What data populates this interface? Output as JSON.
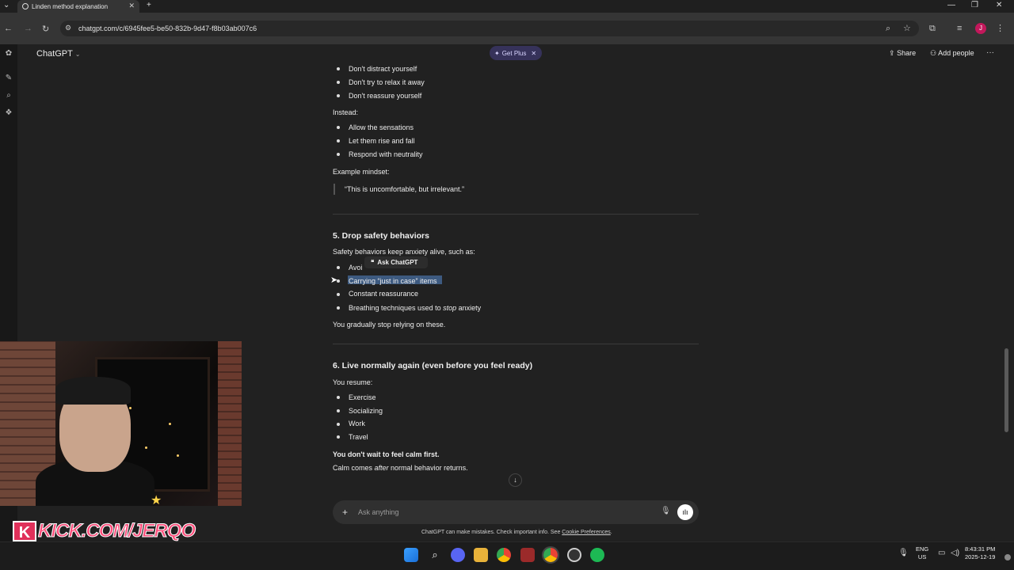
{
  "browser": {
    "tab_title": "Linden method explanation",
    "url": "chatgpt.com/c/6945fee5-be50-832b-9d47-f8b03ab007c6"
  },
  "app": {
    "name": "ChatGPT",
    "get_plus": "Get Plus",
    "share": "Share",
    "add_people": "Add people"
  },
  "content": {
    "list_a": [
      "Don't distract yourself",
      "Don't try to relax it away",
      "Don't reassure yourself"
    ],
    "instead_label": "Instead:",
    "list_b": [
      "Allow the sensations",
      "Let them rise and fall",
      "Respond with neutrality"
    ],
    "example_label": "Example mindset:",
    "quote": "“This is uncomfortable, but irrelevant.”",
    "section5_title": "5. Drop safety behaviors",
    "section5_intro": "Safety behaviors keep anxiety alive, such as:",
    "section5_item1": "Avoi",
    "section5_item2": "Carrying “just in case” items",
    "section5_item3": "Constant reassurance",
    "section5_item4_pre": "Breathing techniques used to ",
    "section5_item4_em": "stop",
    "section5_item4_post": " anxiety",
    "section5_outro": "You gradually stop relying on these.",
    "section6_title": "6. Live normally again (even before you feel ready)",
    "section6_intro": "You resume:",
    "section6_items": [
      "Exercise",
      "Socializing",
      "Work",
      "Travel"
    ],
    "section6_bold": "You don't wait to feel calm first.",
    "section6_last_pre": "Calm comes ",
    "section6_last_em": "after",
    "section6_last_post": " normal behavior returns."
  },
  "popup": {
    "ask_chatgpt": "Ask ChatGPT"
  },
  "composer": {
    "placeholder": "Ask anything",
    "disclaimer": "ChatGPT can make mistakes. Check important info. See ",
    "disclaimer_link": "Cookie Preferences",
    "disclaimer_end": "."
  },
  "overlay": {
    "kick_text": "KICK.COM/JERQO"
  },
  "taskbar": {
    "lang_line1": "ENG",
    "lang_line2": "US",
    "time": "8:43:31 PM",
    "date": "2025-12-19"
  }
}
